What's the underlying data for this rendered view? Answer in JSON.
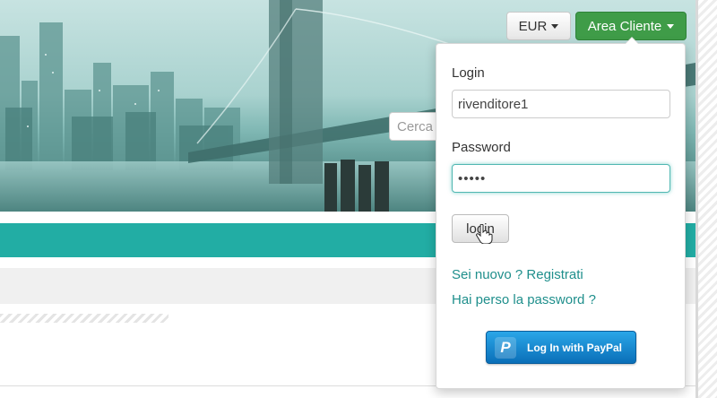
{
  "header": {
    "currency_label": "EUR",
    "area_cliente_label": "Area Cliente",
    "search_placeholder": "Cerca"
  },
  "login_form": {
    "login_label": "Login",
    "login_value": "rivenditore1",
    "password_label": "Password",
    "password_value": "•••••",
    "submit_label": "login",
    "register_link": "Sei nuovo ? Registrati",
    "forgot_link": "Hai perso la password ?",
    "paypal_label": "Log In with PayPal"
  },
  "colors": {
    "primary": "#22ada4",
    "area_button": "#3f9c48",
    "link": "#1f8f8c",
    "paypal": "#0a6fb8"
  },
  "icons": [
    "caret-down-icon",
    "hand-cursor-icon",
    "paypal-icon"
  ]
}
